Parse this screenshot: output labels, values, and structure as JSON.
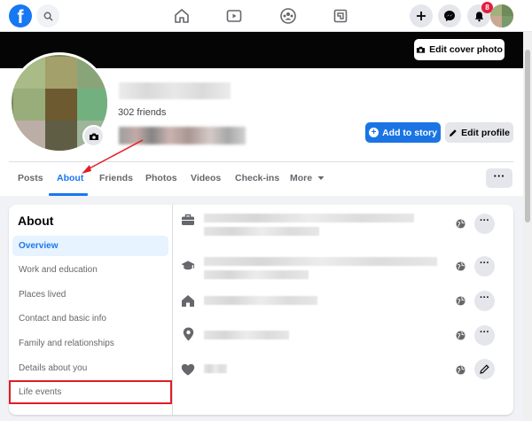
{
  "nav": {
    "logo_letter": "f",
    "notification_count": "8",
    "icons": [
      "search-icon",
      "home-icon",
      "watch-icon",
      "groups-icon",
      "gaming-icon",
      "plus-icon",
      "messenger-icon",
      "bell-icon"
    ]
  },
  "cover": {
    "edit_cover_label": "Edit cover photo"
  },
  "profile": {
    "friends_count": "302 friends",
    "add_story_label": "Add to story",
    "edit_profile_label": "Edit profile"
  },
  "tabs": {
    "posts": "Posts",
    "about": "About",
    "friends": "Friends",
    "photos": "Photos",
    "videos": "Videos",
    "checkins": "Check-ins",
    "more": "More",
    "overflow": "···"
  },
  "about": {
    "title": "About",
    "sidebar": [
      {
        "label": "Overview"
      },
      {
        "label": "Work and education"
      },
      {
        "label": "Places lived"
      },
      {
        "label": "Contact and basic info"
      },
      {
        "label": "Family and relationships"
      },
      {
        "label": "Details about you"
      },
      {
        "label": "Life events"
      }
    ],
    "row_action": "···",
    "rows": [
      {
        "icon": "briefcase-icon"
      },
      {
        "icon": "graduation-cap-icon"
      },
      {
        "icon": "house-icon"
      },
      {
        "icon": "location-pin-icon"
      },
      {
        "icon": "heart-icon"
      }
    ]
  },
  "colors": {
    "accent": "#1877f2",
    "highlight": "#e11d24",
    "annotation_arrow": "#e11d24"
  }
}
